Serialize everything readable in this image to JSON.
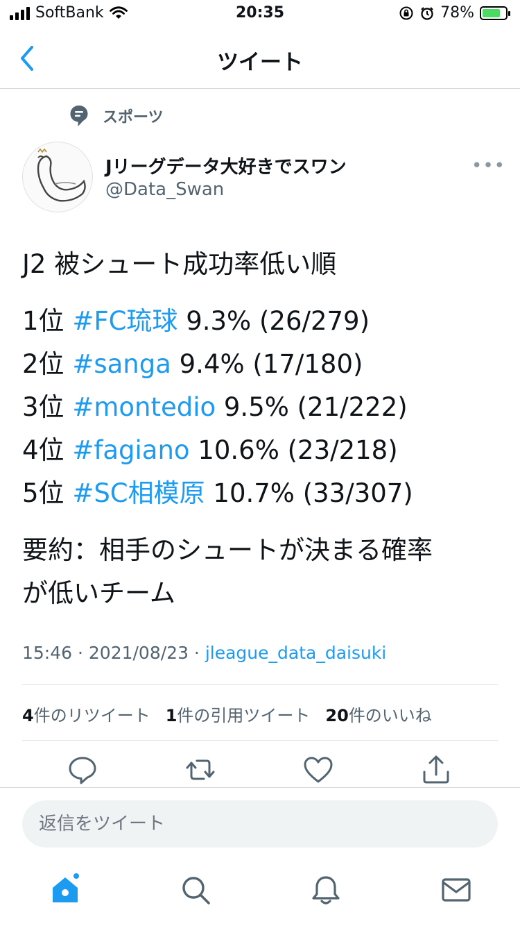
{
  "status_bar": {
    "carrier": "SoftBank",
    "time": "20:35",
    "battery": "78%",
    "battery_level": 0.78
  },
  "nav": {
    "title": "ツイート",
    "back_icon": "chevron-left-icon"
  },
  "tweet": {
    "context": "スポーツ",
    "display_name": "Jリーグデータ大好きでスワン",
    "handle": "@Data_Swan",
    "more": "•••",
    "headline": "J2 被シュート成功率低い順",
    "ranks": [
      {
        "pos": "1位",
        "tag": "#FC琉球",
        "stat": "9.3% (26/279)"
      },
      {
        "pos": "2位",
        "tag": "#sanga",
        "stat": "9.4% (17/180)"
      },
      {
        "pos": "3位",
        "tag": "#montedio",
        "stat": "9.5% (21/222)"
      },
      {
        "pos": "4位",
        "tag": "#fagiano",
        "stat": "10.6% (23/218)"
      },
      {
        "pos": "5位",
        "tag": "#SC相模原",
        "stat": "10.7% (33/307)"
      }
    ],
    "summary_line1": "要約：相手のシュートが決まる確率",
    "summary_line2": "が低いチーム",
    "time": "15:46",
    "date": "2021/08/23",
    "separator": " · ",
    "source": "jleague_data_daisuki"
  },
  "stats": {
    "retweets_count": "4",
    "retweets_label": "件のリツイート",
    "quotes_count": "1",
    "quotes_label": "件の引用ツイート",
    "likes_count": "20",
    "likes_label": "件のいいね"
  },
  "reply": {
    "placeholder": "返信をツイート"
  },
  "colors": {
    "accent": "#1d9bf0",
    "text": "#0f1419",
    "muted": "#536471"
  }
}
